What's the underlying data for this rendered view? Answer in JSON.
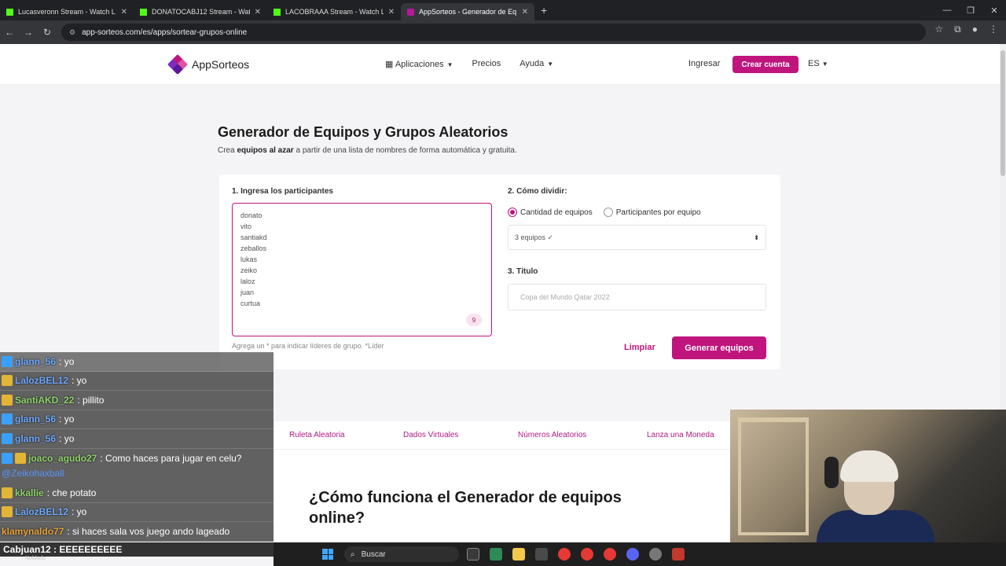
{
  "browser": {
    "tabs": [
      {
        "title": "Lucasveronn Stream - Watch L",
        "icon": "kick-icon",
        "active": false
      },
      {
        "title": "DONATOCABJ12 Stream - Watc",
        "icon": "kick-icon",
        "active": false
      },
      {
        "title": "LACOBRAAA Stream - Watch Li",
        "icon": "kick-icon",
        "active": false
      },
      {
        "title": "AppSorteos - Generador de Eq",
        "icon": "appsorteos-icon",
        "active": true
      }
    ],
    "url": "app-sorteos.com/es/apps/sortear-grupos-online"
  },
  "header": {
    "logo_text": "AppSorteos",
    "nav": {
      "apps": "Aplicaciones",
      "pricing": "Precios",
      "help": "Ayuda"
    },
    "login": "Ingresar",
    "signup": "Crear cuenta",
    "lang": "ES"
  },
  "main": {
    "title": "Generador de Equipos y Grupos Aleatorios",
    "subtitle_pre": "Crea ",
    "subtitle_bold": "equipos al azar",
    "subtitle_post": " a partir de una lista de nombres de forma automática y gratuita."
  },
  "form": {
    "participants_label": "1. Ingresa los participantes",
    "participants": [
      "donato",
      "vito",
      "santiakd",
      "zeballos",
      "lukas",
      "zeiko",
      "laloz",
      "juan",
      "curtua"
    ],
    "participant_count": "9",
    "hint": "Agrega un * para indicar líderes de grupo. *Líder",
    "divide_label": "2. Cómo dividir:",
    "option_teams": "Cantidad de equipos",
    "option_per_team": "Participantes por equipo",
    "teams_select_value": "3 equipos ✓",
    "title_label": "3. Título",
    "title_placeholder": "Copa del Mundo Qatar 2022",
    "clear": "Limpiar",
    "generate": "Generar equipos"
  },
  "links": [
    "Ruleta Aleatoria",
    "Dados Virtuales",
    "Números Aleatorios",
    "Lanza una Moneda"
  ],
  "how": {
    "title": "¿Cómo funciona el Generador de equipos online?"
  },
  "chat": {
    "lines": [
      {
        "user": "glann_56",
        "msg": ": yo",
        "color": "#6fa8ff",
        "badge": "blue"
      },
      {
        "user": "LalozBEL12",
        "msg": ": yo",
        "color": "#6fa8ff",
        "badge": "gold"
      },
      {
        "user": "SantiAKD_22",
        "msg": ": pillito",
        "color": "#8fd46a",
        "badge": "gold"
      },
      {
        "user": "glann_56",
        "msg": ": yo",
        "color": "#6fa8ff",
        "badge": "blue"
      },
      {
        "user": "glann_56",
        "msg": ": yo",
        "color": "#6fa8ff",
        "badge": "blue"
      },
      {
        "user": "joaco_agudo27",
        "msg": ": Como haces para jugar en celu?",
        "color": "#8fd46a",
        "badge": "blue"
      }
    ],
    "mention": "@Zeikohaxball",
    "lines2": [
      {
        "user": "kkallie",
        "msg": ": che potato",
        "color": "#8fd46a",
        "badge": "gold"
      },
      {
        "user": "LalozBEL12",
        "msg": ": yo",
        "color": "#6fa8ff",
        "badge": "gold"
      },
      {
        "user": "klamynaldo77",
        "msg": ": si haces sala vos juego ando lageado",
        "color": "#e8a33a",
        "badge": "none"
      }
    ],
    "bottom": "Cabjuan12 : EEEEEEEEEE"
  },
  "taskbar": {
    "search": "Buscar",
    "weather": "Nublado"
  }
}
